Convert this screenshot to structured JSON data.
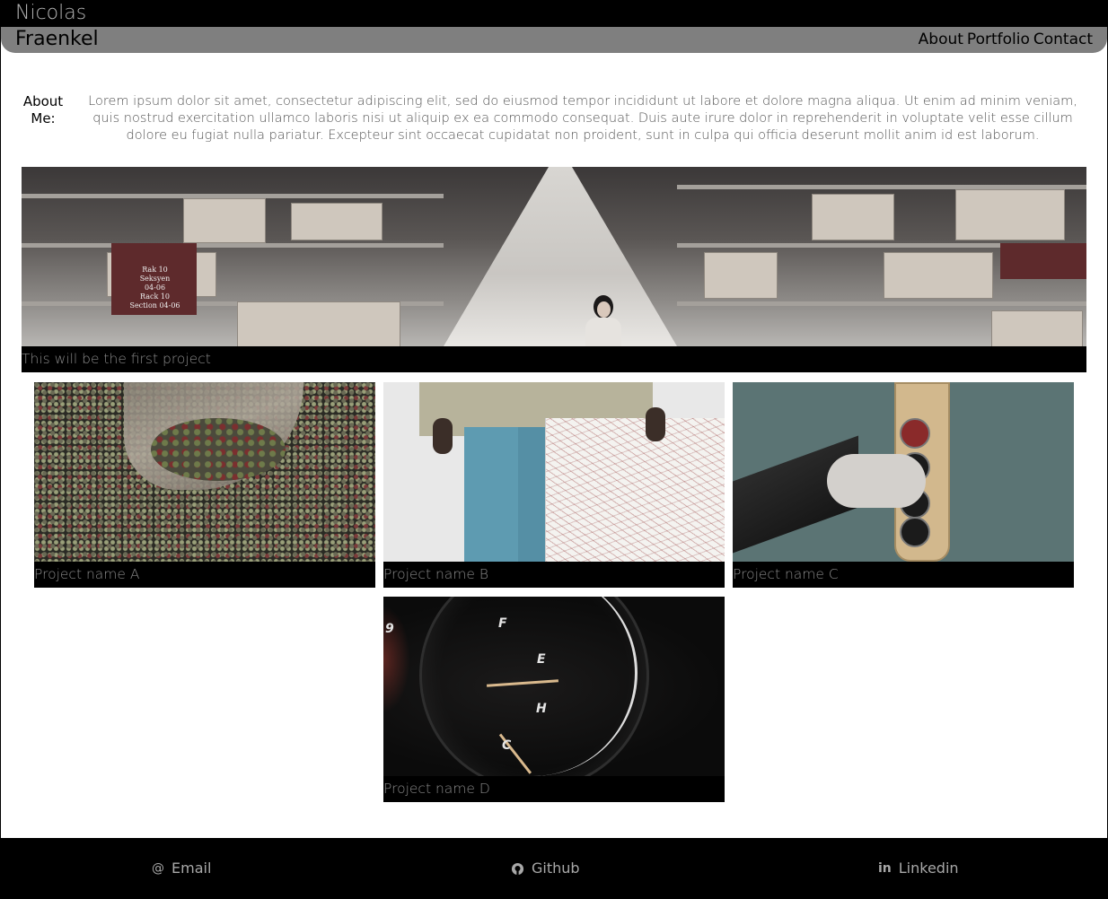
{
  "header": {
    "first_name": "Nicolas",
    "last_name": "Fraenkel",
    "nav": [
      "About",
      "Portfolio",
      "Contact"
    ]
  },
  "about": {
    "label": "About Me:",
    "text": "Lorem ipsum dolor sit amet, consectetur adipiscing elit, sed do eiusmod tempor incididunt ut labore et dolore magna aliqua. Ut enim ad minim veniam, quis nostrud exercitation ullamco laboris nisi ut aliquip ex ea commodo consequat. Duis aute irure dolor in reprehenderit in voluptate velit esse cillum dolore eu fugiat nulla pariatur. Excepteur sint occaecat cupidatat non proident, sunt in culpa qui officia deserunt mollit anim id est laborum."
  },
  "featured": {
    "caption": "This will be the first project",
    "image": "warehouse-aisle-photo",
    "rack_sign": [
      "Rak 10",
      "Seksyen",
      "04-06",
      "Rack 10",
      "Section 04-06"
    ]
  },
  "projects": [
    {
      "caption": "Project name A",
      "image": "coffee-beans-hand-photo"
    },
    {
      "caption": "Project name B",
      "image": "person-holding-map-photo"
    },
    {
      "caption": "Project name C",
      "image": "button-panel-photo"
    },
    {
      "caption": "Project name D",
      "image": "fuel-gauge-photo"
    }
  ],
  "gauge_marks": [
    "F",
    "E",
    "H",
    "C",
    "9"
  ],
  "footer": {
    "email": {
      "label": "Email",
      "icon": "at-icon"
    },
    "github": {
      "label": "Github",
      "icon": "github-icon"
    },
    "linkedin": {
      "label": "Linkedin",
      "icon": "linkedin-icon"
    }
  },
  "colors": {
    "header_top": "#000000",
    "header_bottom": "#7f7f7f",
    "caption_bar": "#000000",
    "caption_text": "#8a8a8a",
    "footer_bg": "#000000",
    "footer_text": "#a8a8a8"
  }
}
